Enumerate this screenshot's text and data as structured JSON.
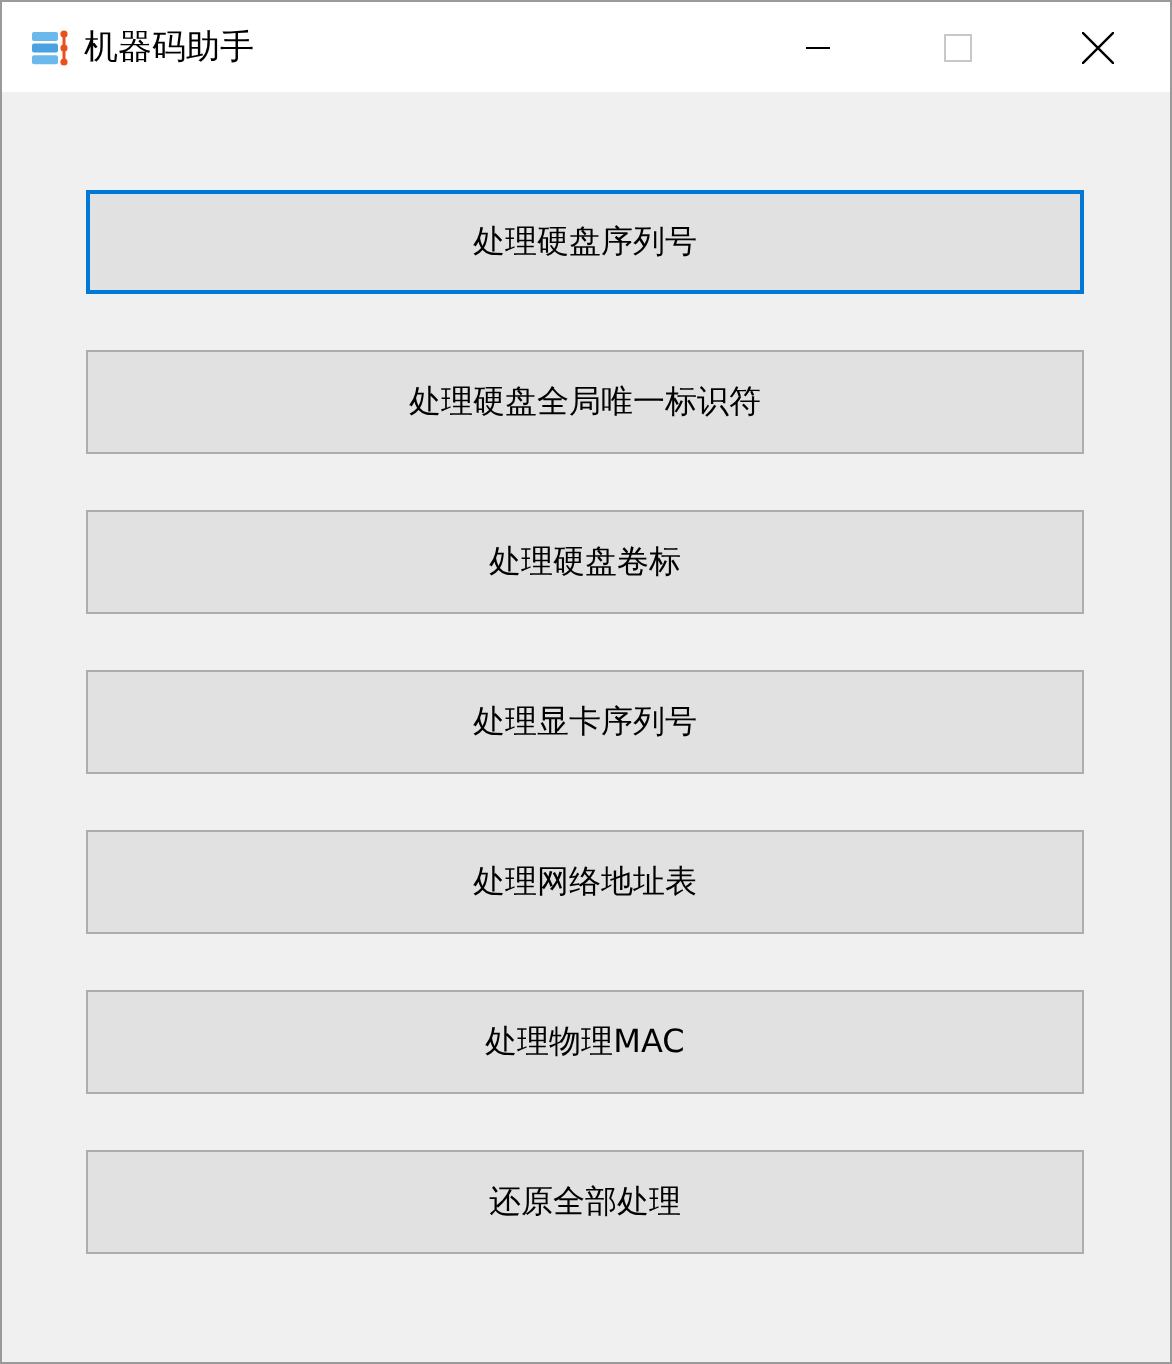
{
  "window": {
    "title": "机器码助手"
  },
  "buttons": [
    {
      "label": "处理硬盘序列号",
      "focused": true
    },
    {
      "label": "处理硬盘全局唯一标识符",
      "focused": false
    },
    {
      "label": "处理硬盘卷标",
      "focused": false
    },
    {
      "label": "处理显卡序列号",
      "focused": false
    },
    {
      "label": "处理网络地址表",
      "focused": false
    },
    {
      "label": "处理物理MAC",
      "focused": false
    },
    {
      "label": "还原全部处理",
      "focused": false
    }
  ]
}
